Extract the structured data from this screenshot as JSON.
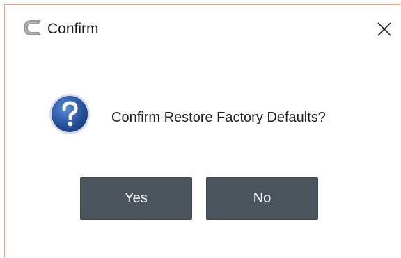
{
  "window": {
    "title": "Confirm",
    "app_icon": "app-logo-icon",
    "close_icon": "close-icon"
  },
  "content": {
    "icon": "question-icon",
    "message": "Confirm Restore Factory Defaults?"
  },
  "buttons": {
    "yes_label": "Yes",
    "no_label": "No"
  },
  "colors": {
    "button_bg": "#4b555e",
    "button_text": "#ffffff",
    "question_icon_blue": "#2d5aa8",
    "border_accent": "#d9a98f"
  }
}
